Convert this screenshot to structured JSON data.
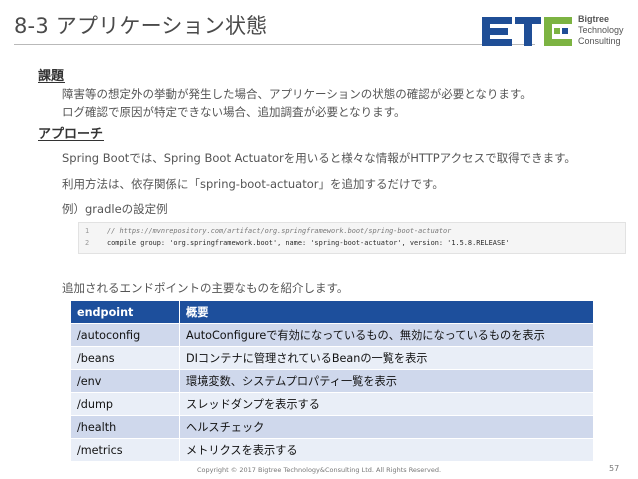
{
  "title": "8-3 アプリケーション状態",
  "logo": {
    "line1": "Bigtree",
    "line2": "Technology",
    "line3": "Consulting"
  },
  "section1": {
    "heading": "課題",
    "lines": [
      "障害等の想定外の挙動が発生した場合、アプリケーションの状態の確認が必要となります。",
      "ログ確認で原因が特定できない場合、追加調査が必要となります。"
    ]
  },
  "section2": {
    "heading": "アプローチ",
    "line1": "Spring Bootでは、Spring Boot Actuatorを用いると様々な情報がHTTPアクセスで取得できます。",
    "line2": "利用方法は、依存関係に「spring-boot-actuator」を追加するだけです。",
    "line3": "例）gradleの設定例",
    "code": [
      {
        "n": "1",
        "text": "// https://mvnrepository.com/artifact/org.springframework.boot/spring-boot-actuator"
      },
      {
        "n": "2",
        "text": "compile group: 'org.springframework.boot', name: 'spring-boot-actuator', version: '1.5.8.RELEASE'"
      }
    ],
    "intro": "追加されるエンドポイントの主要なものを紹介します。"
  },
  "table": {
    "headers": [
      "endpoint",
      "概要"
    ],
    "rows": [
      [
        "/autoconfig",
        "AutoConfigureで有効になっているもの、無効になっているものを表示"
      ],
      [
        "/beans",
        "DIコンテナに管理されているBeanの一覧を表示"
      ],
      [
        "/env",
        "環境変数、システムプロパティ一覧を表示"
      ],
      [
        "/dump",
        "スレッドダンプを表示する"
      ],
      [
        "/health",
        "ヘルスチェック"
      ],
      [
        "/metrics",
        "メトリクスを表示する"
      ]
    ]
  },
  "footer": "Copyright © 2017 Bigtree Technology&Consulting Ltd. All Rights Reserved.",
  "page_number": "57",
  "colors": {
    "header_bg": "#1d4f9c",
    "row_odd": "#cfd8ec",
    "row_even": "#e9eef7",
    "logo_blue": "#1f4e96",
    "logo_green": "#7cb342"
  }
}
